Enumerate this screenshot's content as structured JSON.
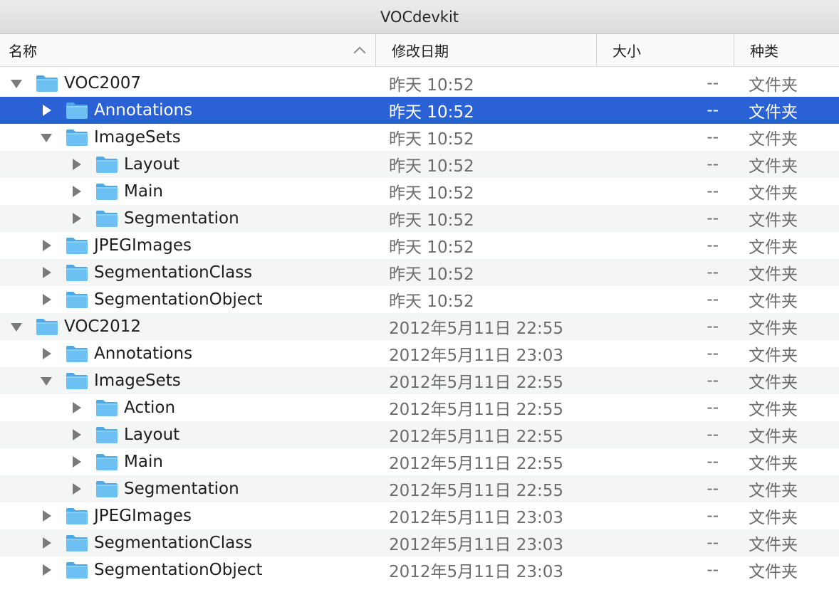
{
  "window": {
    "title": "VOCdevkit"
  },
  "columns": {
    "name": "名称",
    "date": "修改日期",
    "size": "大小",
    "kind": "种类"
  },
  "colors": {
    "selection": "#2a62d6",
    "folder": "#6cc1f2",
    "stripe": "#f4f5f5"
  },
  "rows": [
    {
      "name": "VOC2007",
      "date": "昨天 10:52",
      "size": "--",
      "kind": "文件夹",
      "level": 0,
      "expanded": true,
      "selected": false
    },
    {
      "name": "Annotations",
      "date": "昨天 10:52",
      "size": "--",
      "kind": "文件夹",
      "level": 1,
      "expanded": false,
      "selected": true
    },
    {
      "name": "ImageSets",
      "date": "昨天 10:52",
      "size": "--",
      "kind": "文件夹",
      "level": 1,
      "expanded": true,
      "selected": false
    },
    {
      "name": "Layout",
      "date": "昨天 10:52",
      "size": "--",
      "kind": "文件夹",
      "level": 2,
      "expanded": false,
      "selected": false
    },
    {
      "name": "Main",
      "date": "昨天 10:52",
      "size": "--",
      "kind": "文件夹",
      "level": 2,
      "expanded": false,
      "selected": false
    },
    {
      "name": "Segmentation",
      "date": "昨天 10:52",
      "size": "--",
      "kind": "文件夹",
      "level": 2,
      "expanded": false,
      "selected": false
    },
    {
      "name": "JPEGImages",
      "date": "昨天 10:52",
      "size": "--",
      "kind": "文件夹",
      "level": 1,
      "expanded": false,
      "selected": false
    },
    {
      "name": "SegmentationClass",
      "date": "昨天 10:52",
      "size": "--",
      "kind": "文件夹",
      "level": 1,
      "expanded": false,
      "selected": false
    },
    {
      "name": "SegmentationObject",
      "date": "昨天 10:52",
      "size": "--",
      "kind": "文件夹",
      "level": 1,
      "expanded": false,
      "selected": false
    },
    {
      "name": "VOC2012",
      "date": "2012年5月11日 22:55",
      "size": "--",
      "kind": "文件夹",
      "level": 0,
      "expanded": true,
      "selected": false
    },
    {
      "name": "Annotations",
      "date": "2012年5月11日 23:03",
      "size": "--",
      "kind": "文件夹",
      "level": 1,
      "expanded": false,
      "selected": false
    },
    {
      "name": "ImageSets",
      "date": "2012年5月11日 22:55",
      "size": "--",
      "kind": "文件夹",
      "level": 1,
      "expanded": true,
      "selected": false
    },
    {
      "name": "Action",
      "date": "2012年5月11日 22:55",
      "size": "--",
      "kind": "文件夹",
      "level": 2,
      "expanded": false,
      "selected": false
    },
    {
      "name": "Layout",
      "date": "2012年5月11日 22:55",
      "size": "--",
      "kind": "文件夹",
      "level": 2,
      "expanded": false,
      "selected": false
    },
    {
      "name": "Main",
      "date": "2012年5月11日 22:55",
      "size": "--",
      "kind": "文件夹",
      "level": 2,
      "expanded": false,
      "selected": false
    },
    {
      "name": "Segmentation",
      "date": "2012年5月11日 22:55",
      "size": "--",
      "kind": "文件夹",
      "level": 2,
      "expanded": false,
      "selected": false
    },
    {
      "name": "JPEGImages",
      "date": "2012年5月11日 23:03",
      "size": "--",
      "kind": "文件夹",
      "level": 1,
      "expanded": false,
      "selected": false
    },
    {
      "name": "SegmentationClass",
      "date": "2012年5月11日 23:03",
      "size": "--",
      "kind": "文件夹",
      "level": 1,
      "expanded": false,
      "selected": false
    },
    {
      "name": "SegmentationObject",
      "date": "2012年5月11日 23:03",
      "size": "--",
      "kind": "文件夹",
      "level": 1,
      "expanded": false,
      "selected": false
    }
  ]
}
